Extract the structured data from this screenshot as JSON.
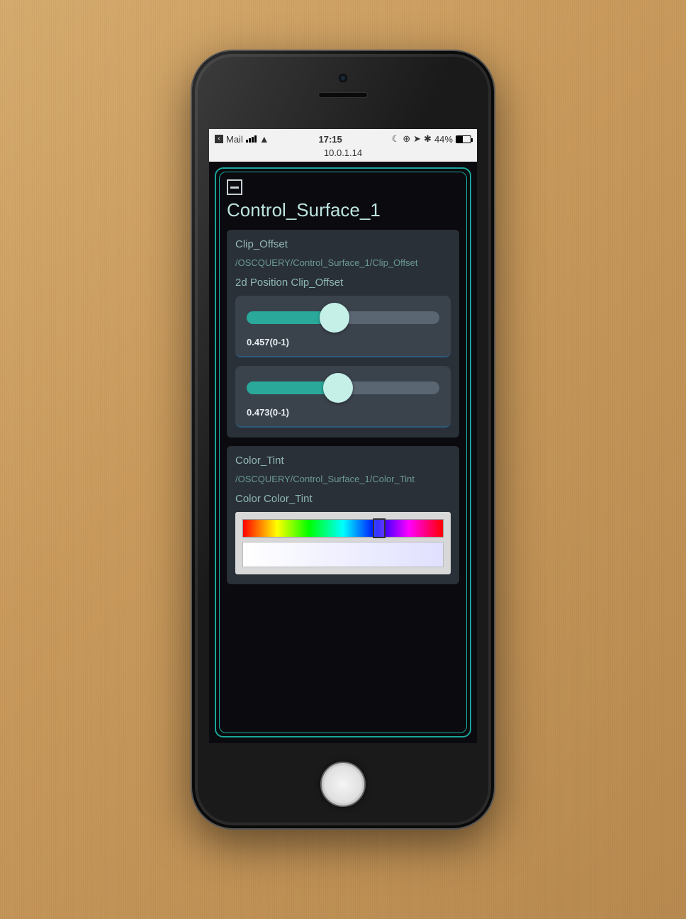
{
  "statusbar": {
    "back_app": "Mail",
    "time": "17:15",
    "battery_pct": "44%",
    "address": "10.0.1.14",
    "icons": {
      "dnd": "☾",
      "orientation_lock": "⊕",
      "location": "➤",
      "bluetooth": "✱"
    }
  },
  "page": {
    "title": "Control_Surface_1",
    "collapse_icon": "collapse"
  },
  "sections": [
    {
      "name": "Clip_Offset",
      "path": "/OSCQUERY/Control_Surface_1/Clip_Offset",
      "control_label": "2d Position Clip_Offset",
      "sliders": [
        {
          "value": 0.457,
          "range": "(0-1)"
        },
        {
          "value": 0.473,
          "range": "(0-1)"
        }
      ]
    },
    {
      "name": "Color_Tint",
      "path": "/OSCQUERY/Control_Surface_1/Color_Tint",
      "control_label": "Color Color_Tint",
      "hue_cursor_pct": 68
    }
  ]
}
